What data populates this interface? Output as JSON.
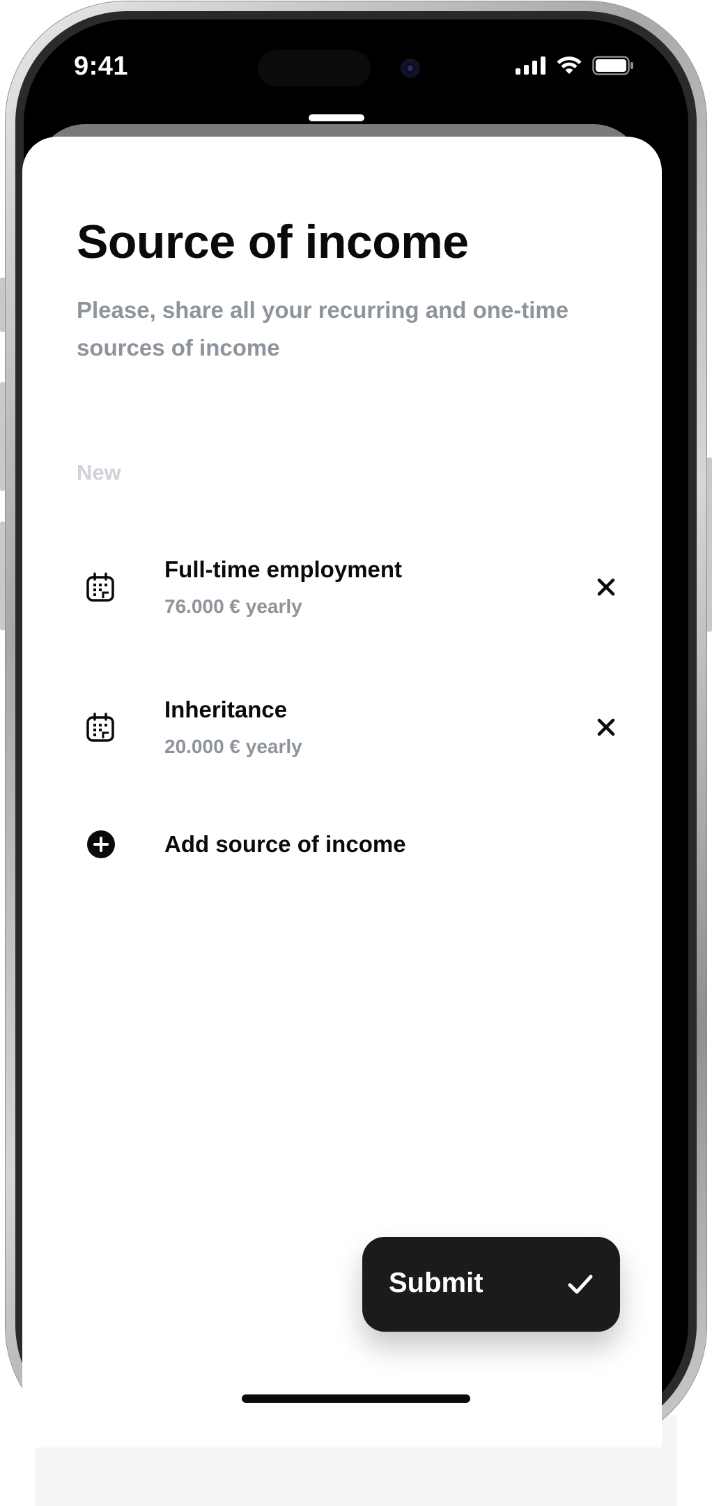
{
  "status_bar": {
    "time": "9:41",
    "icons": [
      "cellular-signal-icon",
      "wifi-icon",
      "battery-icon"
    ]
  },
  "screen": {
    "title": "Source of income",
    "subtitle": "Please, share all your recurring and one-time sources of income",
    "section_label": "New"
  },
  "income_sources": [
    {
      "title": "Full-time employment",
      "amount": "76.000 € yearly",
      "icon": "calendar-icon",
      "remove_icon": "close-icon"
    },
    {
      "title": "Inheritance",
      "amount": "20.000 € yearly",
      "icon": "calendar-icon",
      "remove_icon": "close-icon"
    }
  ],
  "add_action": {
    "label": "Add source of income",
    "icon": "plus-circle-icon"
  },
  "submit": {
    "label": "Submit",
    "icon": "checkmark-icon"
  },
  "colors": {
    "text_primary": "#0a0a0a",
    "text_secondary": "#8e949c",
    "text_muted": "#cfd3d8",
    "button_background": "#1b1b1b",
    "button_text": "#ffffff"
  }
}
